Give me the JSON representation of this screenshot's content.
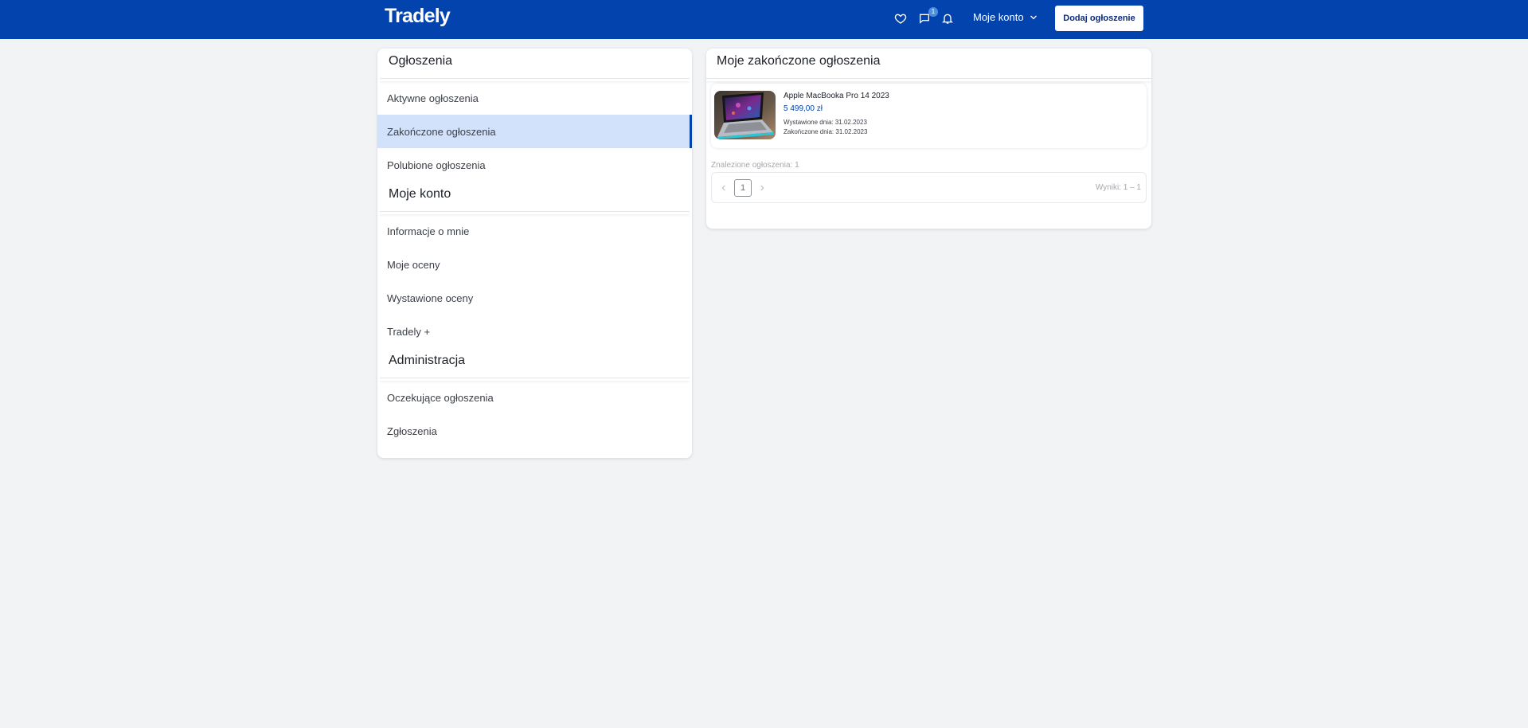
{
  "header": {
    "logo": "Tradely",
    "messages_badge": "1",
    "account_label": "Moje konto",
    "add_button": "Dodaj ogłoszenie"
  },
  "sidebar": {
    "sections": [
      {
        "title": "Ogłoszenia",
        "items": [
          "Aktywne ogłoszenia",
          "Zakończone ogłoszenia",
          "Polubione ogłoszenia"
        ]
      },
      {
        "title": "Moje konto",
        "items": [
          "Informacje o mnie",
          "Moje oceny",
          "Wystawione oceny",
          "Tradely +"
        ]
      },
      {
        "title": "Administracja",
        "items": [
          "Oczekujące ogłoszenia",
          "Zgłoszenia"
        ]
      }
    ],
    "active_item": "Zakończone ogłoszenia"
  },
  "main": {
    "title": "Moje zakończone ogłoszenia",
    "listing": {
      "title": "Apple MacBooka Pro 14 2023",
      "price": "5 499,00 zł",
      "listed": "Wystawione dnia: 31.02.2023",
      "ended": "Zakończone dnia: 31.02.2023"
    },
    "found": "Znalezione ogłoszenia: 1",
    "pagination": {
      "current_page": "1",
      "results": "Wyniki: 1 – 1"
    }
  },
  "colors": {
    "brand": "#0343ad",
    "active_bg": "#d3e2fb",
    "background": "#f2f3f5"
  },
  "icons": [
    "heart-icon",
    "chat-icon",
    "bell-icon",
    "chevron-down-icon",
    "chevron-left-icon",
    "chevron-right-icon"
  ]
}
